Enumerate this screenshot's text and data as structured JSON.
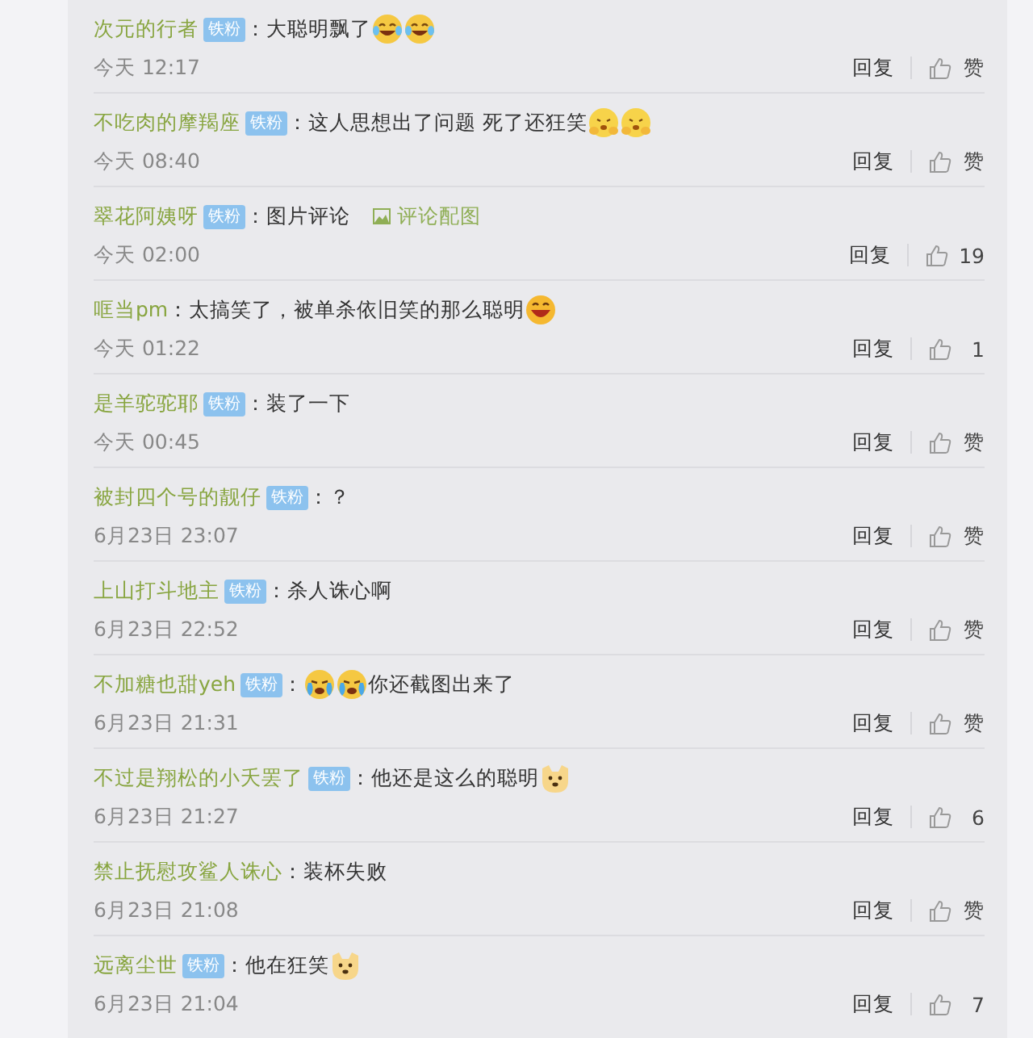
{
  "comments": [
    {
      "user": "次元的行者",
      "badge": "铁粉",
      "separator": "：",
      "content": [
        {
          "kind": "text",
          "text": "大聪明飘了"
        },
        {
          "kind": "laugh-tears"
        },
        {
          "kind": "laugh-tears"
        }
      ],
      "time": "今天 12:17",
      "reply": "回复",
      "like": "赞"
    },
    {
      "user": "不吃肉的摩羯座",
      "badge": "铁粉",
      "separator": "：",
      "content": [
        {
          "kind": "text",
          "text": "这人思想出了问题 死了还狂笑"
        },
        {
          "kind": "peek"
        },
        {
          "kind": "peek"
        }
      ],
      "time": "今天 08:40",
      "reply": "回复",
      "like": "赞"
    },
    {
      "user": "翠花阿姨呀",
      "badge": "铁粉",
      "separator": "：",
      "content": [
        {
          "kind": "text",
          "text": "图片评论"
        },
        {
          "kind": "link",
          "text": "评论配图"
        }
      ],
      "time": "今天 02:00",
      "reply": "回复",
      "like": "19"
    },
    {
      "user": "哐当pm",
      "separator": "：",
      "content": [
        {
          "kind": "text",
          "text": "太搞笑了，被单杀依旧笑的那么聪明"
        },
        {
          "kind": "big-laugh"
        }
      ],
      "time": "今天 01:22",
      "reply": "回复",
      "like": "1"
    },
    {
      "user": "是羊驼驼耶",
      "badge": "铁粉",
      "separator": "：",
      "content": [
        {
          "kind": "text",
          "text": "装了一下"
        }
      ],
      "time": "今天 00:45",
      "reply": "回复",
      "like": "赞"
    },
    {
      "user": "被封四个号的靓仔",
      "badge": "铁粉",
      "separator": "：",
      "content": [
        {
          "kind": "text",
          "text": "？"
        }
      ],
      "time": "6月23日 23:07",
      "reply": "回复",
      "like": "赞"
    },
    {
      "user": "上山打斗地主",
      "badge": "铁粉",
      "separator": "：",
      "content": [
        {
          "kind": "text",
          "text": "杀人诛心啊"
        }
      ],
      "time": "6月23日 22:52",
      "reply": "回复",
      "like": "赞"
    },
    {
      "user": "不加糖也甜yeh",
      "badge": "铁粉",
      "separator": "：",
      "content": [
        {
          "kind": "cry"
        },
        {
          "kind": "cry"
        },
        {
          "kind": "text",
          "text": "你还截图出来了"
        }
      ],
      "time": "6月23日 21:31",
      "reply": "回复",
      "like": "赞"
    },
    {
      "user": "不过是翔松的小夭罢了",
      "badge": "铁粉",
      "separator": "：",
      "content": [
        {
          "kind": "text",
          "text": "他还是这么的聪明"
        },
        {
          "kind": "dog"
        }
      ],
      "time": "6月23日 21:27",
      "reply": "回复",
      "like": "6"
    },
    {
      "user": "禁止抚慰攻鲨人诛心",
      "separator": "：",
      "content": [
        {
          "kind": "text",
          "text": "装杯失败"
        }
      ],
      "time": "6月23日 21:08",
      "reply": "回复",
      "like": "赞"
    },
    {
      "user": "远离尘世",
      "badge": "铁粉",
      "separator": "：",
      "content": [
        {
          "kind": "text",
          "text": "他在狂笑"
        },
        {
          "kind": "dog"
        }
      ],
      "time": "6月23日 21:04",
      "reply": "回复",
      "like": "7"
    }
  ]
}
